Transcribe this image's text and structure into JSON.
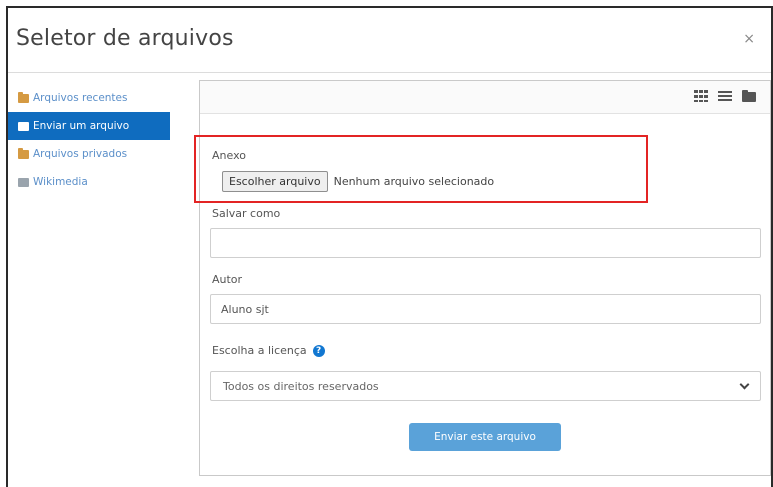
{
  "dialog": {
    "title": "Seletor de arquivos",
    "close_label": "×"
  },
  "sidebar": {
    "items": [
      {
        "label": "Arquivos recentes",
        "icon": "folder-icon",
        "active": false
      },
      {
        "label": "Enviar um arquivo",
        "icon": "upload-icon",
        "active": true
      },
      {
        "label": "Arquivos privados",
        "icon": "folder-icon",
        "active": false
      },
      {
        "label": "Wikimedia",
        "icon": "wikimedia-icon",
        "active": false
      }
    ]
  },
  "toolbar": {
    "view_icons": [
      "grid-view-icon",
      "list-view-icon",
      "tree-view-icon"
    ]
  },
  "form": {
    "attachment": {
      "label": "Anexo",
      "button_label": "Escolher arquivo",
      "status": "Nenhum arquivo selecionado"
    },
    "save_as": {
      "label": "Salvar como",
      "value": ""
    },
    "author": {
      "label": "Autor",
      "value": "Aluno sjt"
    },
    "license": {
      "label": "Escolha a licença",
      "help_icon": "?",
      "selected": "Todos os direitos reservados"
    },
    "submit_label": "Enviar este arquivo"
  },
  "colors": {
    "accent": "#0f6cbf",
    "link": "#5b8fc9",
    "submit": "#5aa2d9",
    "highlight": "#e32424"
  }
}
